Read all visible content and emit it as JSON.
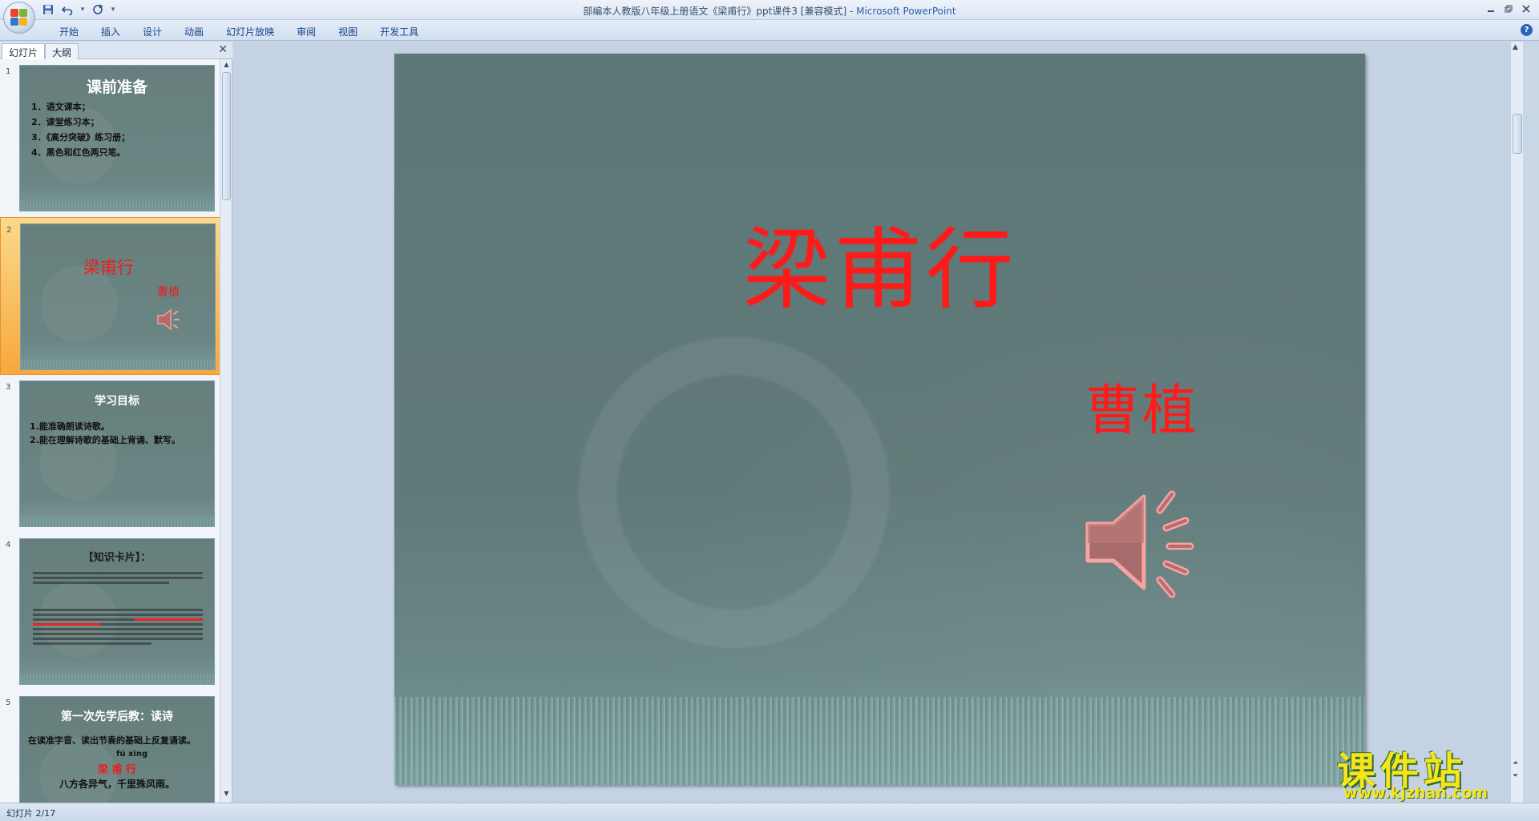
{
  "window": {
    "title": "部编本人教版八年级上册语文《梁甫行》ppt课件3 [兼容模式] - ",
    "app_name": "Microsoft PowerPoint"
  },
  "quick_access": {
    "save_icon": "floppy-disk-icon",
    "undo_icon": "undo-icon",
    "redo_icon": "redo-icon"
  },
  "ribbon": {
    "tabs": [
      "开始",
      "插入",
      "设计",
      "动画",
      "幻灯片放映",
      "审阅",
      "视图",
      "开发工具"
    ]
  },
  "panel": {
    "tab_slides": "幻灯片",
    "tab_outline": "大纲"
  },
  "thumbnails": [
    {
      "number": "1",
      "title": "课前准备",
      "lines": [
        "1．语文课本；",
        "2．课堂练习本；",
        "3．《高分突破》练习册；",
        "4．黑色和红色两只笔。"
      ]
    },
    {
      "number": "2",
      "title": "梁甫行",
      "author": "曹植"
    },
    {
      "number": "3",
      "title": "学习目标",
      "lines": [
        "1.能准确朗读诗歌。",
        "2.能在理解诗歌的基础上背诵、默写。"
      ]
    },
    {
      "number": "4",
      "title": "【知识卡片】："
    },
    {
      "number": "5",
      "title": "第一次先学后教：读诗",
      "lines": [
        "在读准字音、读出节奏的基础上反复诵读。"
      ],
      "pinyin": "fú xìng",
      "poem_title": "梁 甫 行",
      "poem_line1": "八方各异气，千里殊风雨。"
    }
  ],
  "slide": {
    "title": "梁甫行",
    "author": "曹植",
    "audio_icon": "speaker-icon"
  },
  "watermark": {
    "main": "课件站",
    "url": "www.kjzhan.com"
  },
  "status": {
    "text": "幻灯片 2/17"
  },
  "colors": {
    "slide_bg": "#607a79",
    "title_red": "#ff1a1a",
    "selection": "#f7a83e"
  }
}
